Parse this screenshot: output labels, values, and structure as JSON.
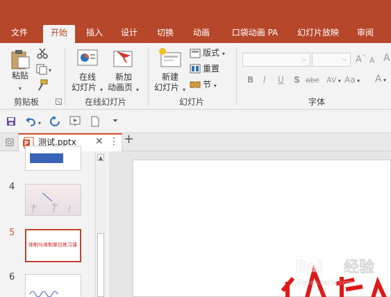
{
  "ribbon_tabs": [
    "文件",
    "开始",
    "插入",
    "设计",
    "切换",
    "动画",
    "口袋动画 PA",
    "幻灯片放映",
    "审阅"
  ],
  "active_tab": "开始",
  "clipboard_group": {
    "paste": "粘贴",
    "label": "剪贴板"
  },
  "online_slides_group": {
    "online_slide": [
      "在线",
      "幻灯片"
    ],
    "new_anim_page": [
      "新加",
      "动画页"
    ],
    "label": "在线幻灯片"
  },
  "slides_group": {
    "new_slide": [
      "新建",
      "幻灯片"
    ],
    "layout": "版式",
    "reset": "重置",
    "section": "节",
    "label": "幻灯片"
  },
  "font_group": {
    "label": "字体",
    "format_buttons": [
      "B",
      "I",
      "U",
      "S",
      "abc",
      "AV",
      "Aa",
      "A"
    ]
  },
  "document_tab": {
    "name": "测试.pptx"
  },
  "thumbnails": [
    {
      "number": "4",
      "selected": false
    },
    {
      "number": "5",
      "selected": true,
      "text": "体制与体制单位练习课"
    },
    {
      "number": "6",
      "selected": false
    }
  ],
  "colors": {
    "brand": "#b7472a",
    "accent": "#d35230"
  }
}
